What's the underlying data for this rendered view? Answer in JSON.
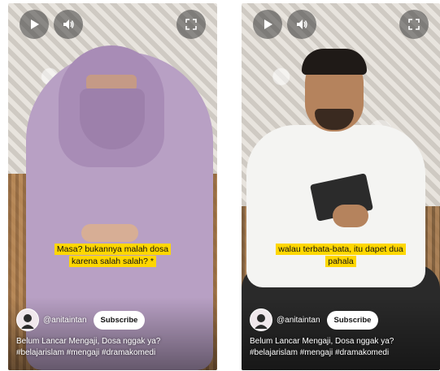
{
  "videos": [
    {
      "caption_line1": "Masa? bukannya malah dosa",
      "caption_line2": "karena salah salah? *",
      "channel": "@anitaintan",
      "subscribe_label": "Subscribe",
      "desc_line1": "Belum Lancar Mengaji, Dosa nggak ya?",
      "desc_line2": "#belajarislam #mengaji #dramakomedi"
    },
    {
      "caption_line1": "walau terbata-bata, itu dapet dua",
      "caption_line2": "pahala",
      "channel": "@anitaintan",
      "subscribe_label": "Subscribe",
      "desc_line1": "Belum Lancar Mengaji, Dosa nggak ya?",
      "desc_line2": "#belajarislam #mengaji #dramakomedi"
    }
  ],
  "icons": {
    "play": "play-icon",
    "volume": "volume-icon",
    "fullscreen": "fullscreen-icon"
  },
  "colors": {
    "caption_bg": "#ffd700",
    "control_bg": "rgba(60,60,60,0.55)"
  }
}
